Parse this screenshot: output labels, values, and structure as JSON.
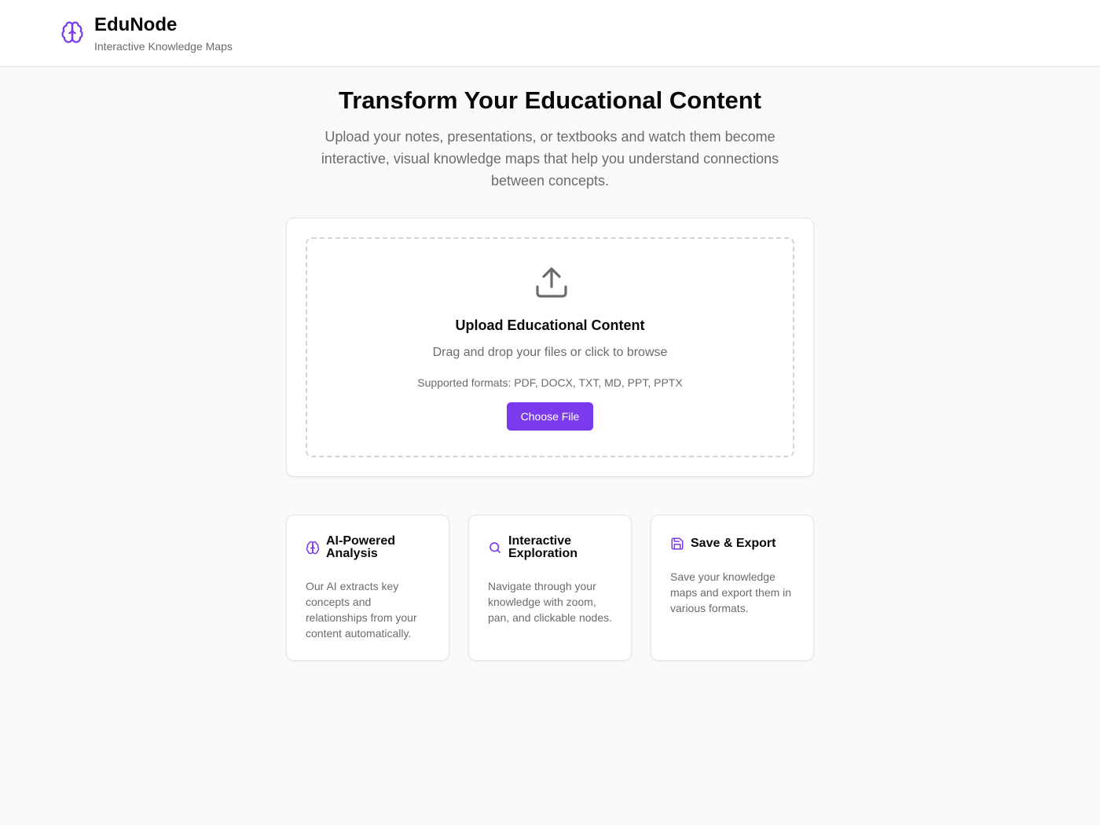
{
  "header": {
    "logo_icon": "brain-icon",
    "title": "EduNode",
    "subtitle": "Interactive Knowledge Maps"
  },
  "hero": {
    "title": "Transform Your Educational Content",
    "description": "Upload your notes, presentations, or textbooks and watch them become interactive, visual knowledge maps that help you understand connections between concepts."
  },
  "upload": {
    "icon": "upload-icon",
    "title": "Upload Educational Content",
    "subtitle": "Drag and drop your files or click to browse",
    "formats": "Supported formats: PDF, DOCX, TXT, MD, PPT, PPTX",
    "button_label": "Choose File"
  },
  "features": [
    {
      "icon": "brain-icon",
      "title": "AI-Powered Analysis",
      "description": "Our AI extracts key concepts and relationships from your content automatically."
    },
    {
      "icon": "search-icon",
      "title": "Interactive Exploration",
      "description": "Navigate through your knowledge with zoom, pan, and clickable nodes."
    },
    {
      "icon": "save-icon",
      "title": "Save & Export",
      "description": "Save your knowledge maps and export them in various formats."
    }
  ],
  "colors": {
    "accent": "#7c3aed",
    "background": "#fafafa",
    "card": "#ffffff",
    "muted_text": "#6b6b6b"
  }
}
